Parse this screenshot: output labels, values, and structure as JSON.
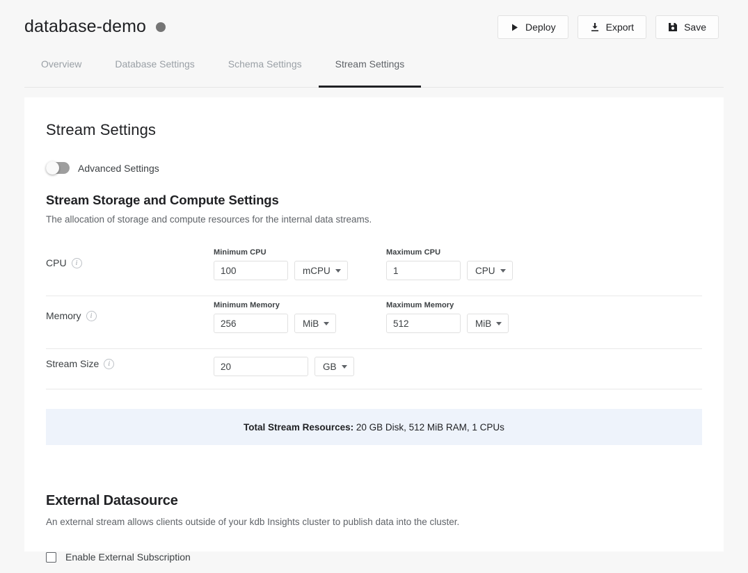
{
  "header": {
    "title": "database-demo",
    "status_dot_color": "#757575",
    "actions": [
      {
        "label": "Deploy",
        "icon": "play-icon"
      },
      {
        "label": "Export",
        "icon": "download-icon"
      },
      {
        "label": "Save",
        "icon": "save-floppy-icon"
      }
    ]
  },
  "tabs": [
    {
      "label": "Overview",
      "active": false
    },
    {
      "label": "Database Settings",
      "active": false
    },
    {
      "label": "Schema Settings",
      "active": false
    },
    {
      "label": "Stream Settings",
      "active": true
    }
  ],
  "main": {
    "section_title": "Stream Settings",
    "advanced_toggle": {
      "label": "Advanced Settings",
      "state": "off"
    },
    "storage": {
      "heading": "Stream Storage and Compute Settings",
      "description": "The allocation of storage and compute resources for the internal data streams.",
      "rows": [
        {
          "label": "CPU",
          "info_icon": "info-circle-icon",
          "fields": [
            {
              "label": "Minimum CPU",
              "value": "100",
              "unit": "mCPU"
            },
            {
              "label": "Maximum CPU",
              "value": "1",
              "unit": "CPU"
            }
          ]
        },
        {
          "label": "Memory",
          "info_icon": "info-circle-icon",
          "fields": [
            {
              "label": "Minimum Memory",
              "value": "256",
              "unit": "MiB"
            },
            {
              "label": "Maximum Memory",
              "value": "512",
              "unit": "MiB"
            }
          ]
        },
        {
          "label": "Stream Size",
          "info_icon": "info-circle-icon",
          "fields": [
            {
              "label": "",
              "value": "20",
              "unit": "GB"
            }
          ]
        }
      ],
      "totals": {
        "label": "Total Stream Resources:",
        "value": "20 GB Disk, 512 MiB RAM, 1 CPUs",
        "background": "#eef3fb"
      }
    },
    "external": {
      "heading": "External Datasource",
      "description": "An external stream allows clients outside of your kdb Insights cluster to publish data into the cluster.",
      "checkbox": {
        "label": "Enable External Subscription",
        "checked": false
      }
    }
  }
}
